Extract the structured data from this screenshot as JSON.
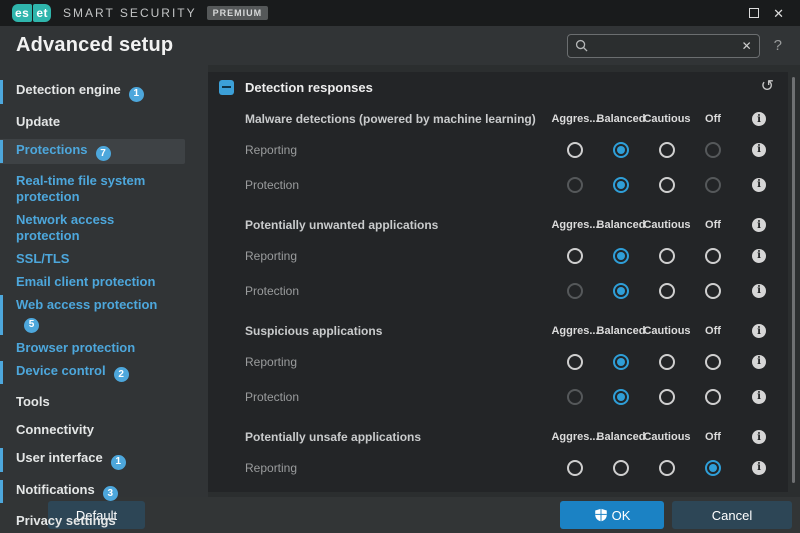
{
  "titlebar": {
    "logo_es": "es",
    "logo_et": "et",
    "product_name": "SMART SECURITY",
    "edition_badge": "PREMIUM"
  },
  "header": {
    "title": "Advanced setup",
    "search_value": "",
    "help_label": "?"
  },
  "sidebar": {
    "items": [
      {
        "label": "Detection engine",
        "badge": "1",
        "bar": true,
        "type": "main"
      },
      {
        "label": "Update",
        "type": "main"
      },
      {
        "label": "Protections",
        "badge": "7",
        "bar": true,
        "selected": true,
        "type": "main"
      },
      {
        "label": "Real-time file system protection",
        "type": "sub"
      },
      {
        "label": "Network access protection",
        "type": "sub"
      },
      {
        "label": "SSL/TLS",
        "type": "sub"
      },
      {
        "label": "Email client protection",
        "type": "sub"
      },
      {
        "label": "Web access protection",
        "badge": "5",
        "bar": true,
        "type": "sub"
      },
      {
        "label": "Browser protection",
        "type": "sub"
      },
      {
        "label": "Device control",
        "badge": "2",
        "bar": true,
        "type": "sub"
      },
      {
        "label": "Tools",
        "type": "main"
      },
      {
        "label": "Connectivity",
        "type": "main"
      },
      {
        "label": "User interface",
        "badge": "1",
        "bar": true,
        "type": "main"
      },
      {
        "label": "Notifications",
        "badge": "3",
        "bar": true,
        "type": "main"
      },
      {
        "label": "Privacy settings",
        "type": "main"
      }
    ]
  },
  "main": {
    "panel_title": "Detection responses",
    "columns": [
      "Aggres...",
      "Balanced",
      "Cautious",
      "Off"
    ],
    "sections": [
      {
        "title": "Malware detections (powered by machine learning)",
        "rows": [
          {
            "label": "Reporting",
            "states": [
              "normal",
              "selected",
              "normal",
              "dim"
            ]
          },
          {
            "label": "Protection",
            "states": [
              "dim",
              "selected",
              "normal",
              "dim"
            ]
          }
        ]
      },
      {
        "title": "Potentially unwanted applications",
        "rows": [
          {
            "label": "Reporting",
            "states": [
              "normal",
              "selected",
              "normal",
              "normal"
            ]
          },
          {
            "label": "Protection",
            "states": [
              "dim",
              "selected",
              "normal",
              "normal"
            ]
          }
        ]
      },
      {
        "title": "Suspicious applications",
        "rows": [
          {
            "label": "Reporting",
            "states": [
              "normal",
              "selected",
              "normal",
              "normal"
            ]
          },
          {
            "label": "Protection",
            "states": [
              "dim",
              "selected",
              "normal",
              "normal"
            ]
          }
        ]
      },
      {
        "title": "Potentially unsafe applications",
        "rows": [
          {
            "label": "Reporting",
            "states": [
              "normal",
              "normal",
              "normal",
              "selected"
            ]
          }
        ]
      }
    ]
  },
  "footer": {
    "default_label": "Default",
    "ok_label": "OK",
    "cancel_label": "Cancel"
  },
  "colors": {
    "accent": "#4da7dc",
    "radio_selected": "#2f9fd8",
    "ok_button": "#1b82c4",
    "eset_teal": "#2fb5ac",
    "panel_bg": "#232527",
    "chrome_bg": "#313436"
  }
}
